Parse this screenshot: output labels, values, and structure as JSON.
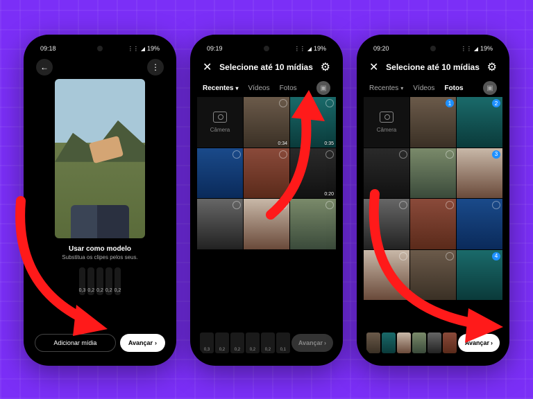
{
  "colors": {
    "accent": "#ff1a1a",
    "bg": "#7b2ff7",
    "select": "#1e90ff"
  },
  "status": {
    "time1": "09:18",
    "time2": "09:19",
    "time3": "09:20",
    "battery": "19%"
  },
  "phone1": {
    "title": "Usar como modelo",
    "subtitle": "Substitua os clipes pelos seus.",
    "clips": [
      "0,3",
      "0,2",
      "0,2",
      "0,2",
      "0,2"
    ],
    "add_media": "Adicionar mídia",
    "next": "Avançar"
  },
  "picker": {
    "title": "Selecione até 10 mídias",
    "tab_recent": "Recentes",
    "tab_videos": "Vídeos",
    "tab_photos": "Fotos",
    "camera": "Câmera",
    "next": "Avançar"
  },
  "phone2": {
    "durations": {
      "cell2": "0:34",
      "cell3": "0:35",
      "cell6": "0:20"
    },
    "slots": [
      "0,3",
      "0,2",
      "0,2",
      "0,2",
      "0,2",
      "0,1"
    ]
  },
  "phone3": {
    "selection": {
      "cell2": "1",
      "cell3": "2",
      "cell6": "3",
      "cell12": "4"
    }
  }
}
